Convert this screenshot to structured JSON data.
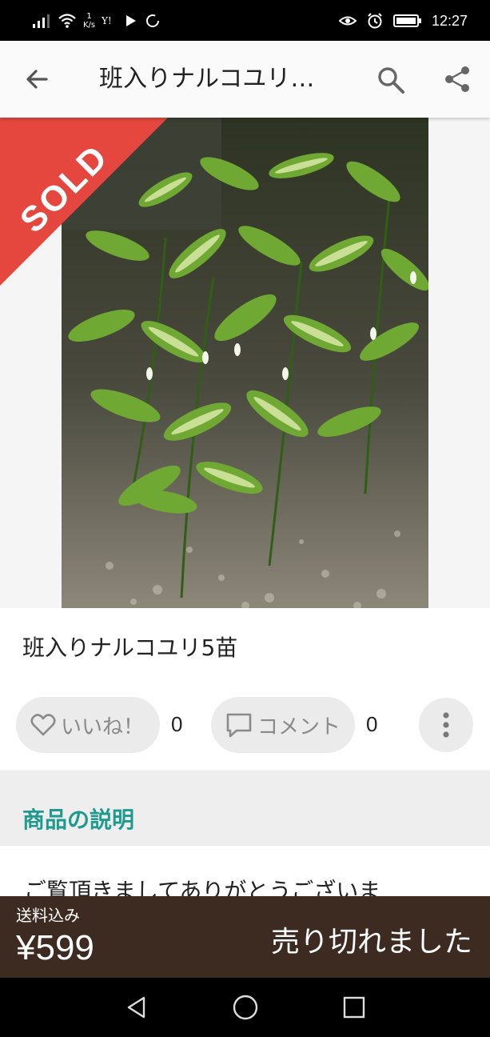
{
  "status_bar": {
    "speed": "1\nK/s",
    "time": "12:27"
  },
  "app_bar": {
    "title": "班入りナルコユリ…"
  },
  "ribbon": {
    "text": "SOLD",
    "color": "#e5463e"
  },
  "item": {
    "title": "班入りナルコユリ5苗"
  },
  "actions": {
    "like_label": "いいね！",
    "like_count": "0",
    "comment_label": "コメント",
    "comment_count": "0"
  },
  "section": {
    "title": "商品の説明",
    "color": "#1e9b8e"
  },
  "description": {
    "first_line": "ご覧頂きましてありがとうございま"
  },
  "purchase_bar": {
    "shipping_label": "送料込み",
    "price": "¥599",
    "status": "売り切れました",
    "color": "#3d2a21"
  },
  "icons": [
    "back-arrow-icon",
    "search-icon",
    "share-icon",
    "heart-icon",
    "comment-icon",
    "more-vertical-icon",
    "nav-back-icon",
    "nav-home-icon",
    "nav-recent-icon",
    "wifi-icon",
    "signal-icon",
    "eye-icon",
    "alarm-icon",
    "battery-icon"
  ]
}
